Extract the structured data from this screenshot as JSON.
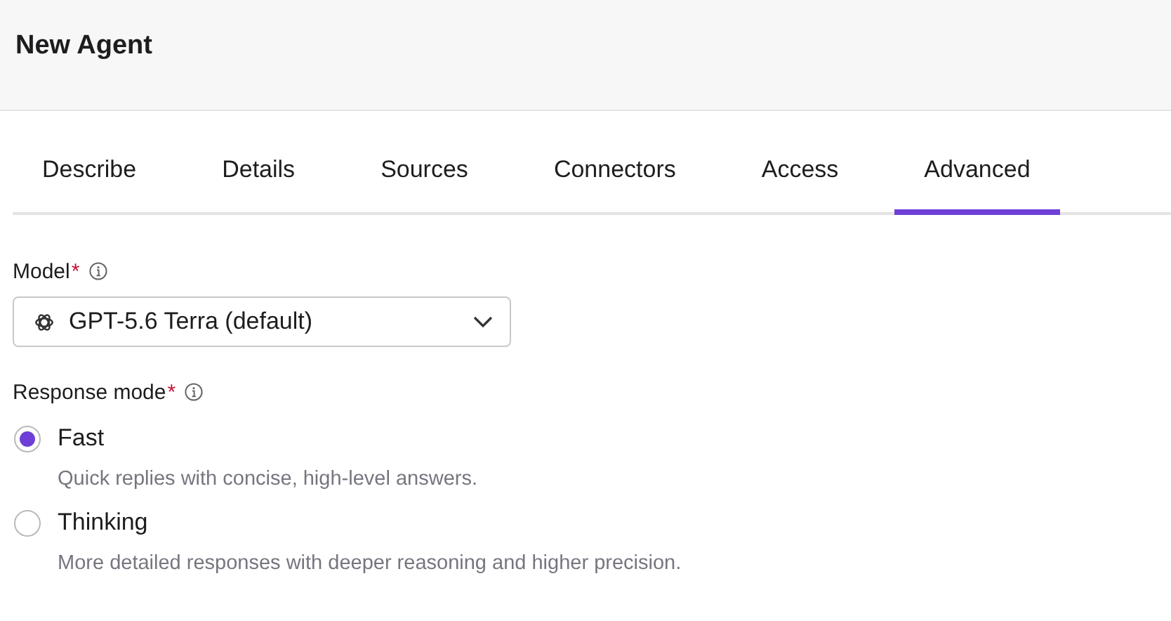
{
  "header": {
    "title": "New Agent"
  },
  "tabs": [
    {
      "label": "Describe",
      "selected": false
    },
    {
      "label": "Details",
      "selected": false
    },
    {
      "label": "Sources",
      "selected": false
    },
    {
      "label": "Connectors",
      "selected": false
    },
    {
      "label": "Access",
      "selected": false
    },
    {
      "label": "Advanced",
      "selected": true
    }
  ],
  "model": {
    "label": "Model",
    "required_mark": "*",
    "value": "GPT-5.6 Terra (default)"
  },
  "response_mode": {
    "label": "Response mode",
    "required_mark": "*",
    "options": [
      {
        "label": "Fast",
        "description": "Quick replies with concise, high-level answers.",
        "selected": true
      },
      {
        "label": "Thinking",
        "description": "More detailed responses with deeper reasoning and higher precision.",
        "selected": false
      }
    ]
  }
}
